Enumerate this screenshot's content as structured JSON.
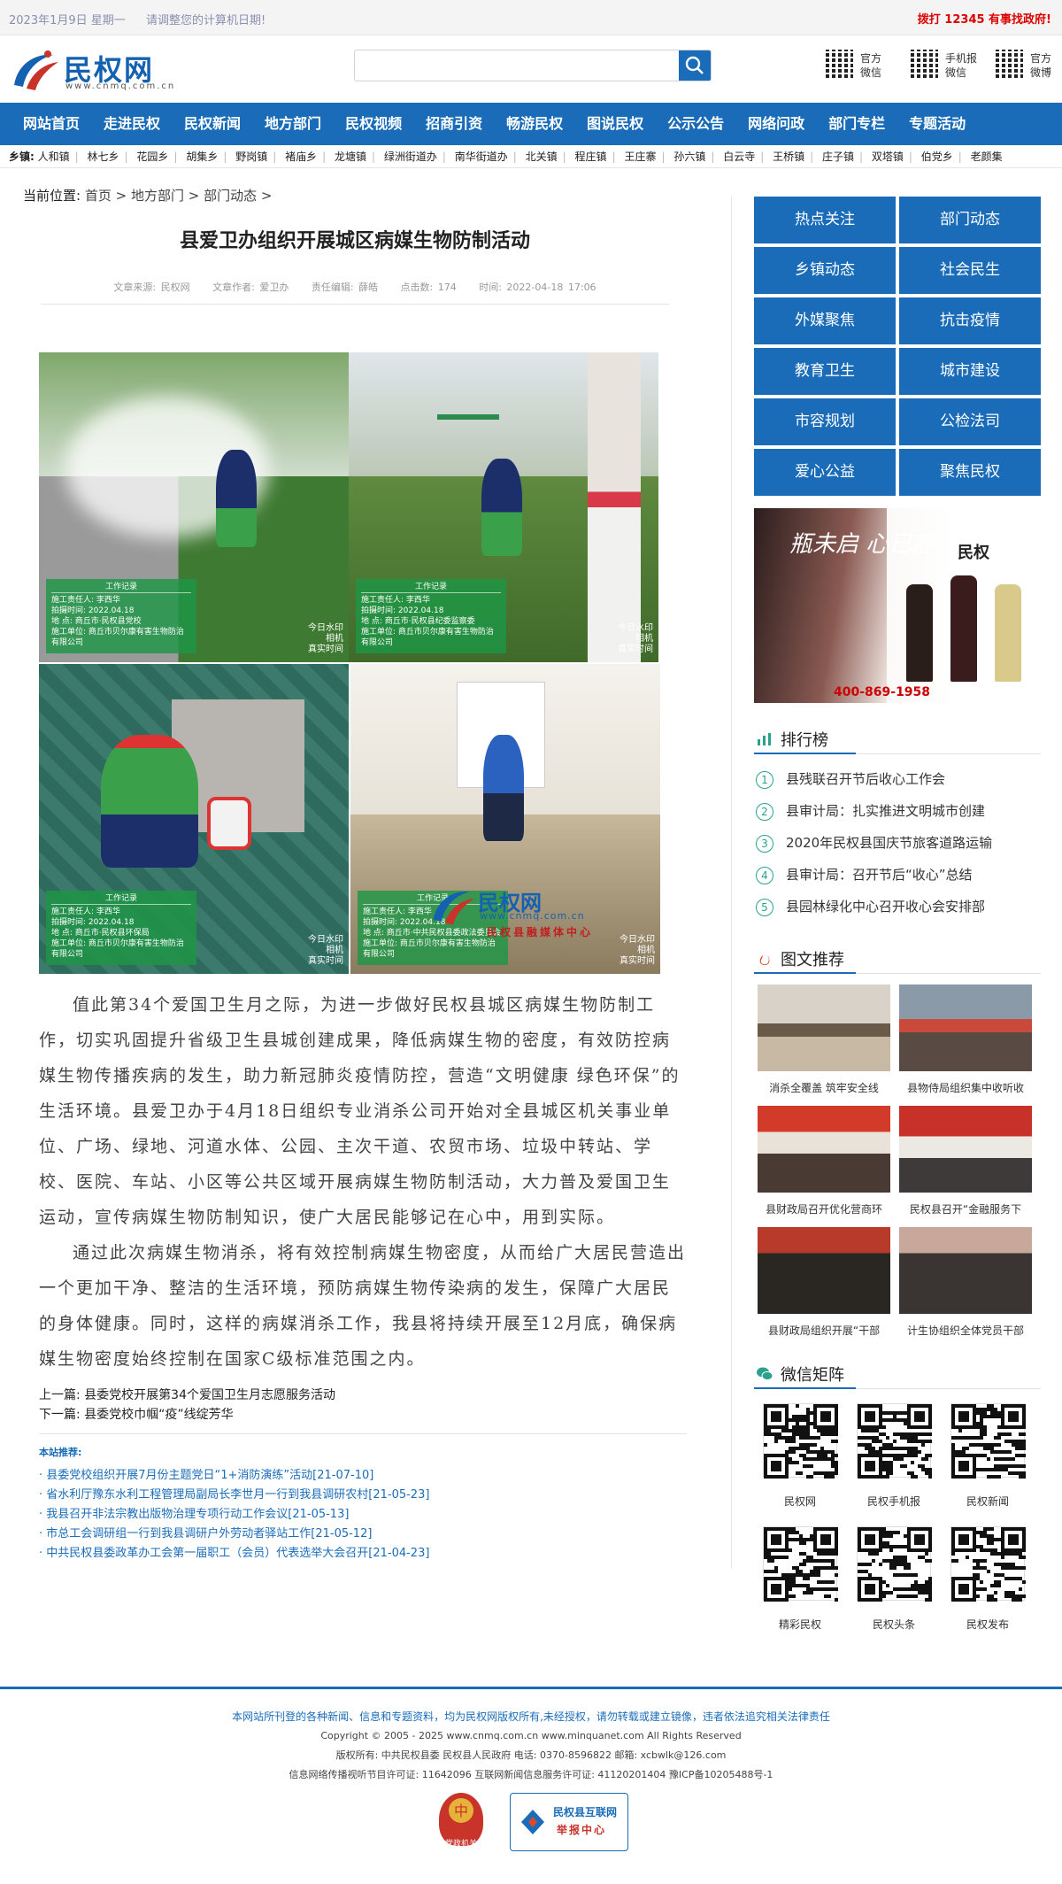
{
  "topbar": {
    "date": "2023年1月9日 星期一",
    "notice": "请调整您的计算机日期!",
    "hotline": "拨打 12345 有事找政府!"
  },
  "header": {
    "logo_text": "民权网",
    "logo_url": "www.cnmq.com.cn",
    "search_placeholder": "",
    "qr_labels": [
      "官方\n微信",
      "手机报\n微信",
      "官方\n微博"
    ]
  },
  "nav": [
    "网站首页",
    "走进民权",
    "民权新闻",
    "地方部门",
    "民权视频",
    "招商引资",
    "畅游民权",
    "图说民权",
    "公示公告",
    "网络问政",
    "部门专栏",
    "专题活动"
  ],
  "towns": {
    "label": "乡镇:",
    "items": [
      "人和镇",
      "林七乡",
      "花园乡",
      "胡集乡",
      "野岗镇",
      "褚庙乡",
      "龙塘镇",
      "绿洲街道办",
      "南华街道办",
      "北关镇",
      "程庄镇",
      "王庄寨",
      "孙六镇",
      "白云寺",
      "王桥镇",
      "庄子镇",
      "双塔镇",
      "伯党乡",
      "老颜集"
    ]
  },
  "breadcrumb": {
    "label": "当前位置:",
    "items": [
      "首页",
      "地方部门",
      "部门动态"
    ]
  },
  "article": {
    "title": "县爱卫办组织开展城区病媒生物防制活动",
    "source": "文章来源: 民权网",
    "author": "文章作者: 爱卫办",
    "editor": "责任编辑: 薛皓",
    "views": "点击数: 174",
    "time": "时间: 2022-04-18 17:06",
    "photo_cards": [
      {
        "title": "工作记录",
        "lines": [
          "施工责任人: 李西华",
          "拍摄时间: 2022.04.18",
          "地 点: 商丘市·民权县党校",
          "施工单位: 商丘市贝尔康有害生物防治有限公司"
        ]
      },
      {
        "title": "工作记录",
        "lines": [
          "施工责任人: 李西华",
          "拍摄时间: 2022.04.18",
          "地 点: 商丘市·民权县纪委监察委",
          "施工单位: 商丘市贝尔康有害生物防治有限公司"
        ]
      },
      {
        "title": "工作记录",
        "lines": [
          "施工责任人: 李西华",
          "拍摄时间: 2022.04.18",
          "地 点: 商丘市·民权县环保局",
          "施工单位: 商丘市贝尔康有害生物防治有限公司"
        ]
      },
      {
        "title": "工作记录",
        "lines": [
          "施工责任人: 李西华",
          "拍摄时间: 2022.04.18",
          "地 点: 商丘市·中共民权县委政法委员会",
          "施工单位: 商丘市贝尔康有害生物防治有限公司"
        ]
      }
    ],
    "photo_stamp": "今日水印\n相机\n真实时间",
    "watermark": {
      "text": "民权网",
      "url": "www.cnmq.com.cn",
      "sub": "民权县融媒体中心"
    },
    "paragraphs": [
      "值此第34个爱国卫生月之际，为进一步做好民权县城区病媒生物防制工作，切实巩固提升省级卫生县城创建成果，降低病媒生物的密度，有效防控病媒生物传播疾病的发生，助力新冠肺炎疫情防控，营造“文明健康 绿色环保”的生活环境。县爱卫办于4月18日组织专业消杀公司开始对全县城区机关事业单位、广场、绿地、河道水体、公园、主次干道、农贸市场、垃圾中转站、学校、医院、车站、小区等公共区域开展病媒生物防制活动，大力普及爱国卫生运动，宣传病媒生物防制知识，使广大居民能够记在心中，用到实际。",
      "通过此次病媒生物消杀，将有效控制病媒生物密度，从而给广大居民营造出一个更加干净、整洁的生活环境，预防病媒生物传染病的发生，保障广大居民的身体健康。同时，这样的病媒消杀工作，我县将持续开展至12月底，确保病媒生物密度始终控制在国家C级标准范围之内。"
    ],
    "prev": "上一篇: 县委党校开展第34个爱国卫生月志愿服务活动",
    "next": "下一篇: 县委党校巾帼“疫”线绽芳华"
  },
  "related": {
    "header": "本站推荐:",
    "items": [
      "· 县委党校组织开展7月份主题党日“1+消防演练”活动[21-07-10]",
      "· 省水利厅豫东水利工程管理局副局长李世月一行到我县调研农村[21-05-23]",
      "· 我县召开非法宗教出版物治理专项行动工作会议[21-05-13]",
      "· 市总工会调研组一行到我县调研户外劳动者驿站工作[21-05-12]",
      "· 中共民权县委政革办工会第一届职工（会员）代表选举大会召开[21-04-23]"
    ]
  },
  "sidebar": {
    "categories": [
      "热点关注",
      "部门动态",
      "乡镇动态",
      "社会民生",
      "外媒聚焦",
      "抗击疫情",
      "教育卫生",
      "城市建设",
      "市容规划",
      "公检法司",
      "爱心公益",
      "聚焦民权"
    ],
    "ad": {
      "slogan": "瓶未启 心已静",
      "brand": "民权",
      "phone": "400-869-1958"
    },
    "ranking_title": "排行榜",
    "ranking": [
      "县残联召开节后收心工作会",
      "县审计局：扎实推进文明城市创建",
      "2020年民权县国庆节旅客道路运输",
      "县审计局：召开节后“收心”总结",
      "县园林绿化中心召开收心会安排部"
    ],
    "pics_title": "图文推荐",
    "pics": [
      "消杀全覆盖 筑牢安全线",
      "县物侍局组织集中收听收",
      "县财政局召开优化营商环",
      "民权县召开“金融服务下",
      "县财政局组织开展“干部",
      "计生协组织全体党员干部"
    ],
    "wechat_title": "微信矩阵",
    "wechat": [
      "民权网",
      "民权手机报",
      "民权新闻",
      "精彩民权",
      "民权头条",
      "民权发布"
    ]
  },
  "footer": {
    "line1": "本网站所刊登的各种新闻、信息和专题资料，均为民权网版权所有,未经授权，请勿转载或建立镜像，违者依法追究相关法律责任",
    "line2": "Copyright © 2005 - 2025 www.cnmq.com.cn www.minquanet.com All Rights Reserved",
    "line3": "版权所有: 中共民权县委 民权县人民政府 电话: 0370-8596822 邮箱: xcbwlk@126.com",
    "line4": "信息网络传播视听节目许可证: 11642096 互联网新闻信息服务许可证: 41120201404 豫ICP备10205488号-1",
    "badge1": "党政机关",
    "badge2_title": "民权县互联网",
    "badge2_sub": "举报中心"
  },
  "colors": {
    "primary": "#1a6cb8",
    "alert": "#dd0000"
  }
}
